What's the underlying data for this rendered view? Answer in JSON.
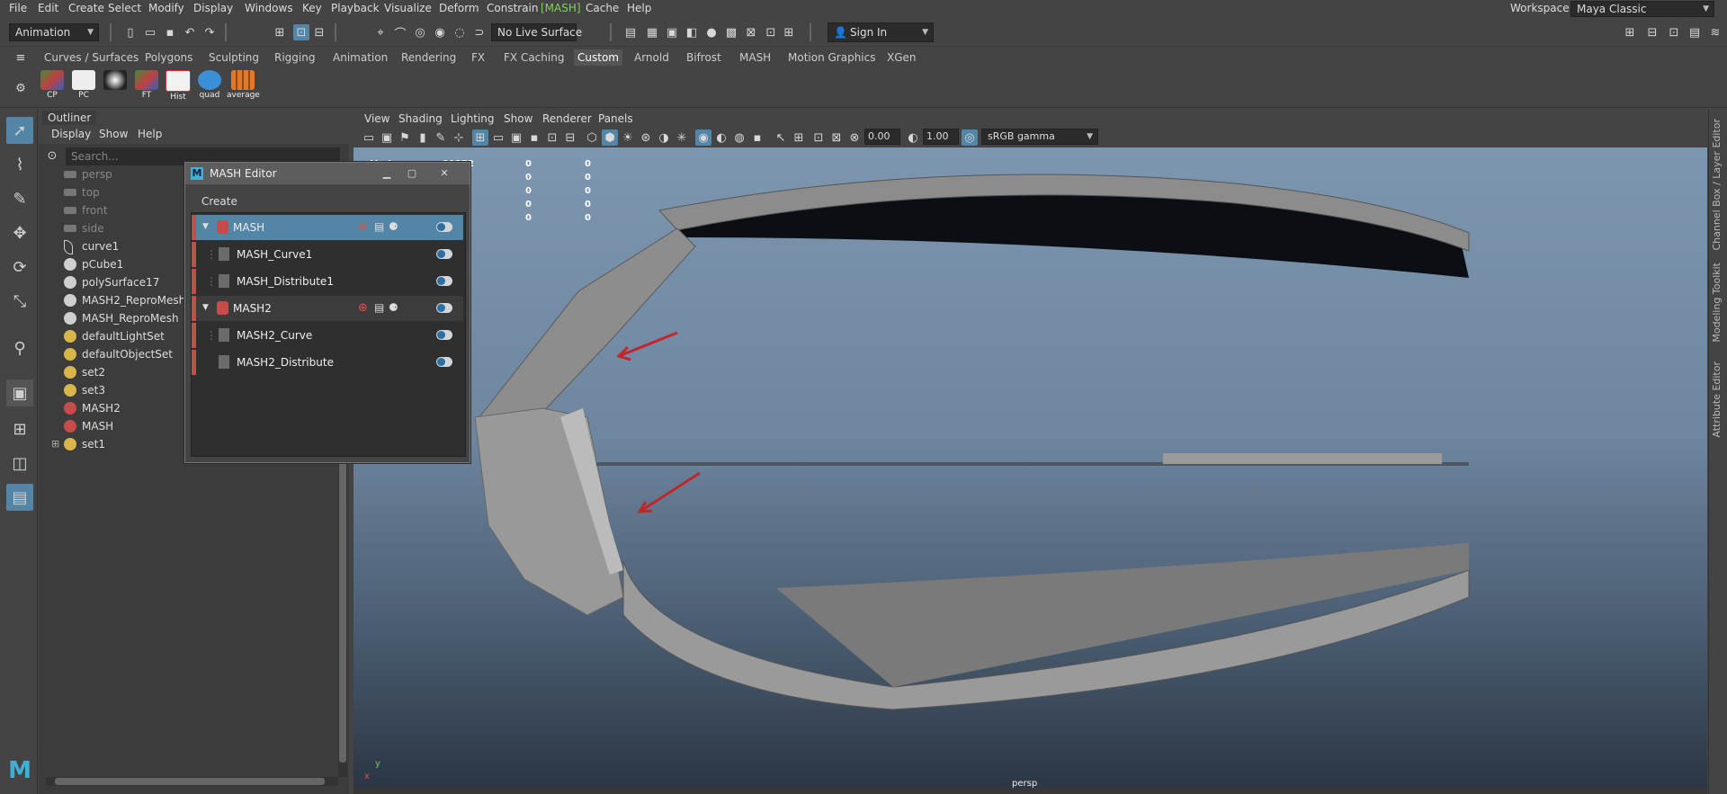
{
  "menubar": {
    "items": [
      "File",
      "Edit",
      "Create",
      "Select",
      "Modify",
      "Display",
      "Windows",
      "Key",
      "Playback",
      "Visualize",
      "Deform",
      "Constrain",
      "[MASH]",
      "Cache",
      "Help"
    ],
    "workspace_label": "Workspace :",
    "workspace_value": "Maya Classic"
  },
  "statusline": {
    "menuset": "Animation",
    "live_surface": "No Live Surface",
    "sign_in": "Sign In"
  },
  "shelf": {
    "tabs": [
      "Curves / Surfaces",
      "Polygons",
      "Sculpting",
      "Rigging",
      "Animation",
      "Rendering",
      "FX",
      "FX Caching",
      "Custom",
      "Arnold",
      "Bifrost",
      "MASH",
      "Motion Graphics",
      "XGen"
    ],
    "active_tab": "Custom",
    "buttons": [
      "CP",
      "PC",
      "",
      "FT",
      "Hist",
      "quad",
      "average"
    ]
  },
  "outliner": {
    "tab": "Outliner",
    "menus": [
      "Display",
      "Show",
      "Help"
    ],
    "search_placeholder": "Search...",
    "items": [
      {
        "label": "persp",
        "icon": "camera-icon",
        "dim": true
      },
      {
        "label": "top",
        "icon": "camera-icon",
        "dim": true
      },
      {
        "label": "front",
        "icon": "camera-icon",
        "dim": true
      },
      {
        "label": "side",
        "icon": "camera-icon",
        "dim": true
      },
      {
        "label": "curve1",
        "icon": "curve-icon",
        "dim": false
      },
      {
        "label": "pCube1",
        "icon": "mesh-icon",
        "dim": false
      },
      {
        "label": "polySurface17",
        "icon": "mesh-icon",
        "dim": false
      },
      {
        "label": "MASH2_ReproMesh",
        "icon": "mesh-icon",
        "dim": false
      },
      {
        "label": "MASH_ReproMesh",
        "icon": "mesh-icon",
        "dim": false
      },
      {
        "label": "defaultLightSet",
        "icon": "set-icon",
        "dim": false
      },
      {
        "label": "defaultObjectSet",
        "icon": "set-icon",
        "dim": false
      },
      {
        "label": "set2",
        "icon": "set-icon",
        "dim": false
      },
      {
        "label": "set3",
        "icon": "set-icon",
        "dim": false
      },
      {
        "label": "MASH2",
        "icon": "mash-icon",
        "dim": false
      },
      {
        "label": "MASH",
        "icon": "mash-icon",
        "dim": false
      },
      {
        "label": "set1",
        "icon": "set-icon",
        "dim": false
      }
    ]
  },
  "viewport": {
    "menus": [
      "View",
      "Shading",
      "Lighting",
      "Show",
      "Renderer",
      "Panels"
    ],
    "exposure": "0.00",
    "gamma": "1.00",
    "color_space": "sRGB gamma",
    "hud": {
      "verts_label": "Verts:",
      "rows": [
        [
          "99372",
          "0",
          "0"
        ],
        [
          "",
          "0",
          "0"
        ],
        [
          "",
          "0",
          "0"
        ],
        [
          "",
          "0",
          "0"
        ],
        [
          "",
          "0",
          "0"
        ]
      ]
    },
    "camera_name": "persp",
    "axis_y": "y",
    "axis_x": "x"
  },
  "mash_editor": {
    "title": "MASH Editor",
    "create_menu": "Create",
    "rows": [
      {
        "label": "MASH",
        "type": "network"
      },
      {
        "label": "MASH_Curve1",
        "type": "node"
      },
      {
        "label": "MASH_Distribute1",
        "type": "node"
      },
      {
        "label": "MASH2",
        "type": "network"
      },
      {
        "label": "MASH2_Curve",
        "type": "node"
      },
      {
        "label": "MASH2_Distribute",
        "type": "node"
      }
    ]
  },
  "right_tabs": [
    "Channel Box / Layer Editor",
    "Modeling Toolkit",
    "Attribute Editor"
  ],
  "colors": {
    "accent": "#5285a6",
    "mash_red": "#c84b4b",
    "highlight_green": "#7fd257"
  }
}
